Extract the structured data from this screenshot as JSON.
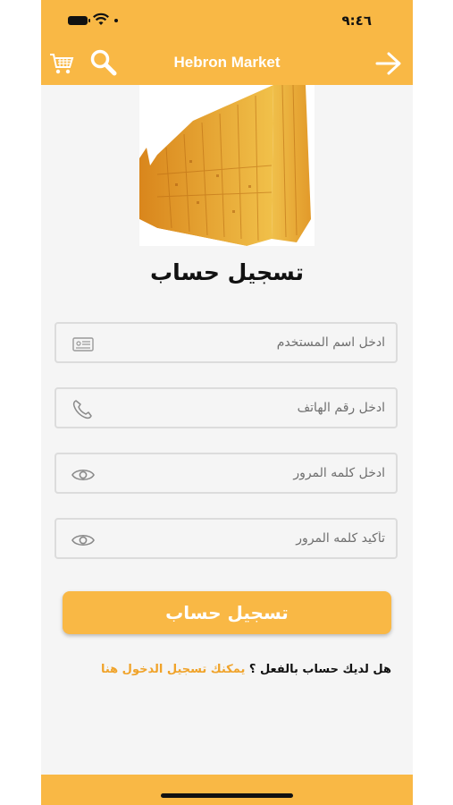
{
  "status": {
    "time": "٩:٤٦"
  },
  "nav": {
    "title": "Hebron Market"
  },
  "page": {
    "heading": "تسجيل حساب"
  },
  "form": {
    "username_placeholder": "ادخل اسم المستخدم",
    "phone_placeholder": "ادخل رقم الهاتف",
    "password_placeholder": "ادخل كلمه المرور",
    "confirm_placeholder": "تأكيد كلمه المرور",
    "submit_label": "تسجيل حساب"
  },
  "login_prompt": {
    "question": "هل لديك حساب بالفعل ؟",
    "link": "يمكنك تسجيل الدخول هنا"
  },
  "icons": {
    "cart": "cart-icon",
    "search": "search-icon",
    "forward": "arrow-right-icon",
    "id_card": "id-card-icon",
    "phone": "phone-icon",
    "eye": "eye-icon"
  },
  "colors": {
    "accent": "#f9b845",
    "link": "#f0a32a"
  }
}
